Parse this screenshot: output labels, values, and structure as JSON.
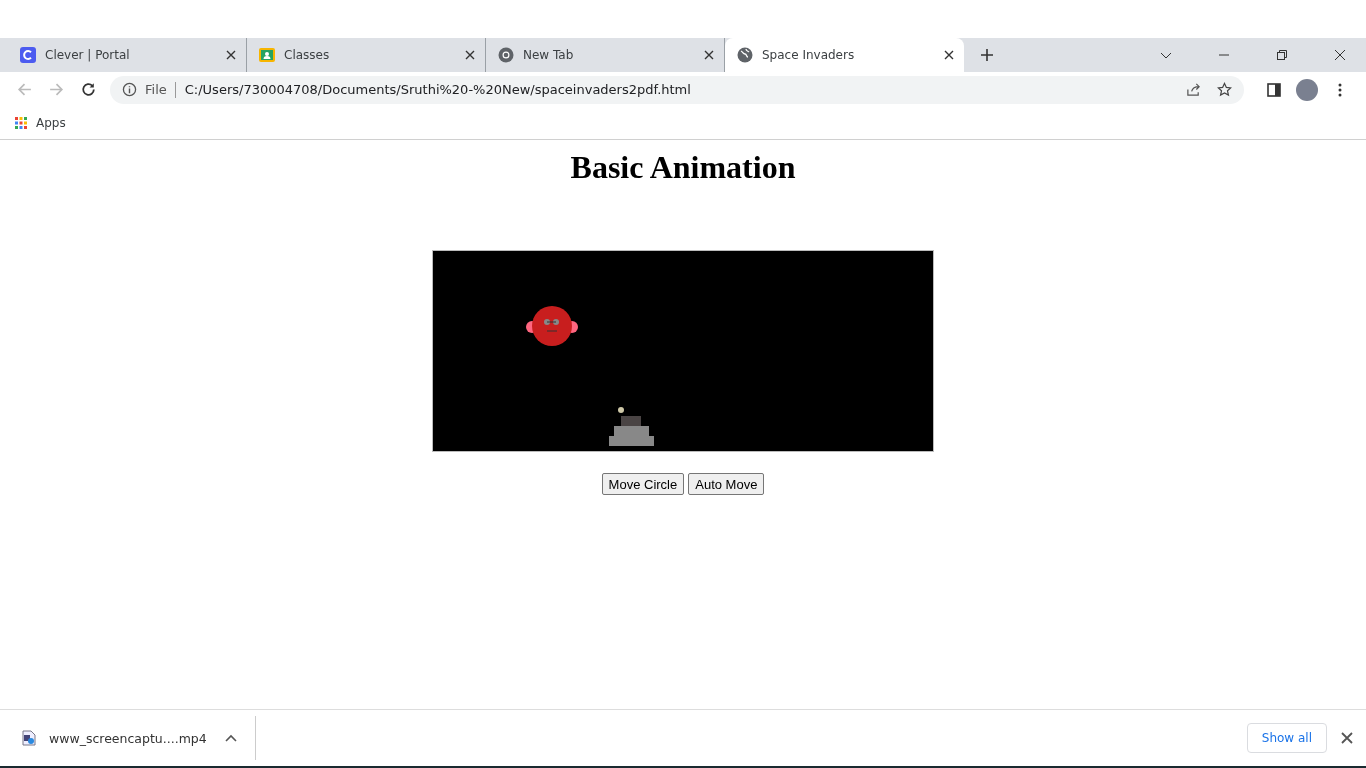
{
  "tabs": [
    {
      "label": "Clever | Portal",
      "selected": false
    },
    {
      "label": "Classes",
      "selected": false
    },
    {
      "label": "New Tab",
      "selected": false
    },
    {
      "label": "Space Invaders",
      "selected": true
    }
  ],
  "address": {
    "scheme": "File",
    "url": "C:/Users/730004708/Documents/Sruthi%20-%20New/spaceinvaders2pdf.html"
  },
  "bookmarks": [
    "Apps"
  ],
  "page": {
    "heading": "Basic Animation",
    "buttons": [
      "Move Circle",
      "Auto Move"
    ]
  },
  "downloads": {
    "file": "www_screencaptu....mp4",
    "show_all": "Show all"
  }
}
